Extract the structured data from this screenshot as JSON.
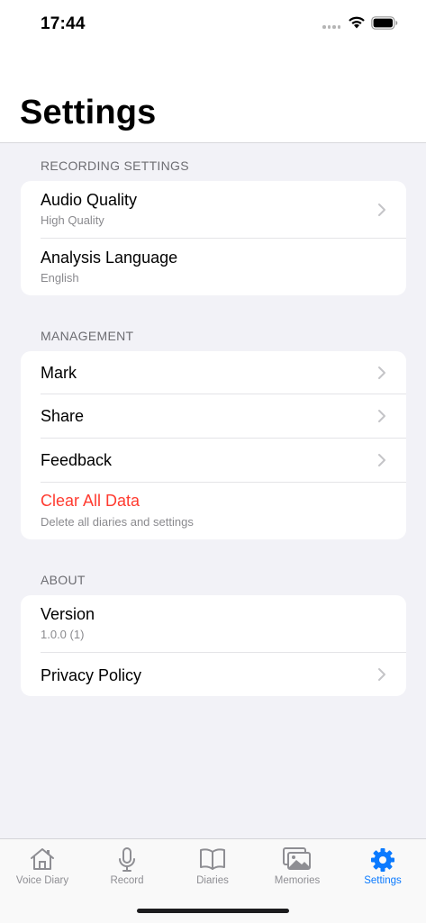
{
  "status_bar": {
    "time": "17:44"
  },
  "header": {
    "title": "Settings"
  },
  "sections": {
    "recording": {
      "header": "RECORDING SETTINGS",
      "audio_quality": {
        "title": "Audio Quality",
        "subtitle": "High Quality"
      },
      "analysis_language": {
        "title": "Analysis Language",
        "subtitle": "English"
      }
    },
    "management": {
      "header": "MANAGEMENT",
      "mark": {
        "title": "Mark"
      },
      "share": {
        "title": "Share"
      },
      "feedback": {
        "title": "Feedback"
      },
      "clear_all": {
        "title": "Clear All Data",
        "subtitle": "Delete all diaries and settings"
      }
    },
    "about": {
      "header": "ABOUT",
      "version": {
        "title": "Version",
        "subtitle": "1.0.0 (1)"
      },
      "privacy": {
        "title": "Privacy Policy"
      }
    }
  },
  "tab_bar": {
    "tabs": [
      {
        "label": "Voice Diary",
        "icon": "house-icon"
      },
      {
        "label": "Record",
        "icon": "microphone-icon"
      },
      {
        "label": "Diaries",
        "icon": "book-icon"
      },
      {
        "label": "Memories",
        "icon": "photos-icon"
      },
      {
        "label": "Settings",
        "icon": "gear-icon"
      }
    ],
    "active_index": 4
  },
  "colors": {
    "accent": "#0a7aff",
    "danger": "#ff3b30",
    "background": "#f2f2f7",
    "inactive_tab": "#8e8e93"
  }
}
